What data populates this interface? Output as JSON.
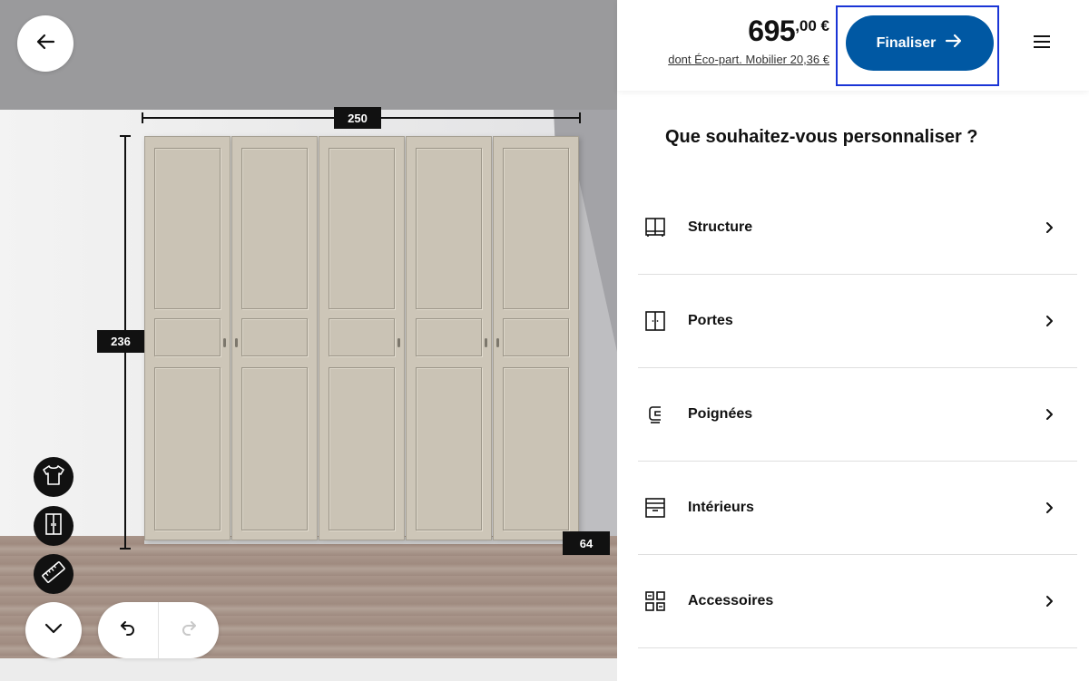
{
  "dimensions": {
    "width": "250",
    "height": "236",
    "depth": "64"
  },
  "scene_buttons": {
    "back": "arrow-left-icon",
    "wardrobe_contents": "tshirt-icon",
    "doors_view": "wardrobe-doors-icon",
    "measure": "ruler-icon",
    "collapse": "chevron-down-icon",
    "undo": "undo-icon",
    "redo": "redo-icon"
  },
  "header": {
    "price_int": "695",
    "price_dec": ",00 €",
    "eco_fee": "dont Éco-part. Mobilier 20,36 €",
    "finalise_label": "Finaliser",
    "menu": "hamburger-icon"
  },
  "heading": "Que souhaitez-vous personnaliser ?",
  "options": [
    {
      "label": "Structure",
      "icon": "structure-icon"
    },
    {
      "label": "Portes",
      "icon": "doors-icon"
    },
    {
      "label": "Poignées",
      "icon": "handles-icon"
    },
    {
      "label": "Intérieurs",
      "icon": "interiors-icon"
    },
    {
      "label": "Accessoires",
      "icon": "accessories-icon"
    }
  ],
  "colors": {
    "brand_blue": "#0058a3",
    "highlight": "#1a35d6",
    "door": "#cdc6b8"
  }
}
